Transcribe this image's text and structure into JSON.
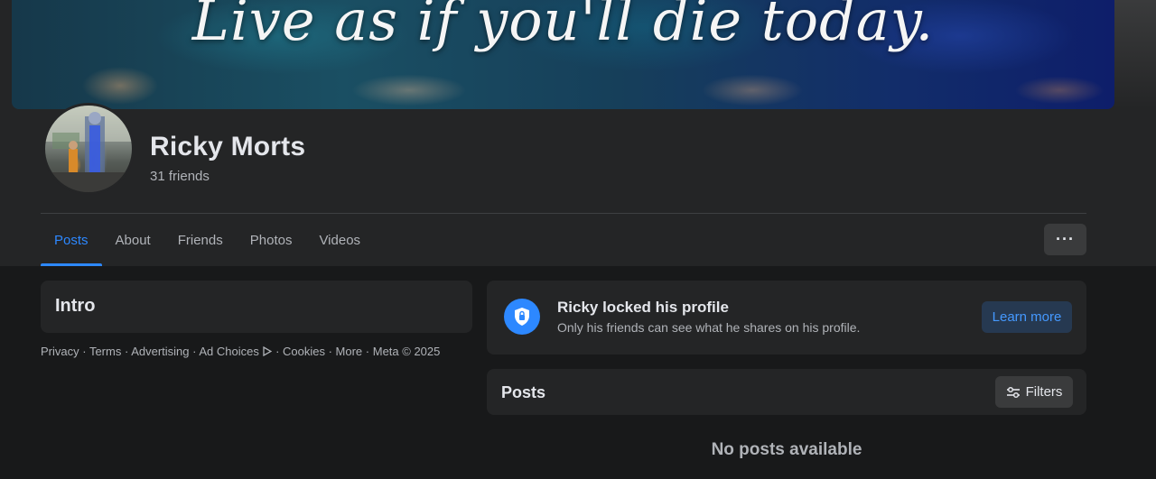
{
  "cover": {
    "quote": "Live as if you'll die today."
  },
  "profile": {
    "name": "Ricky Morts",
    "friends": "31 friends"
  },
  "tabs": [
    {
      "label": "Posts",
      "active": true
    },
    {
      "label": "About"
    },
    {
      "label": "Friends"
    },
    {
      "label": "Photos"
    },
    {
      "label": "Videos"
    }
  ],
  "more_button": {
    "label": "···",
    "icon": "more-horizontal-icon"
  },
  "intro": {
    "title": "Intro"
  },
  "footer": {
    "links": [
      "Privacy",
      "Terms",
      "Advertising",
      "Ad Choices",
      "Cookies",
      "More"
    ],
    "separator": " · ",
    "ad_choices_icon": "ad-choices-icon",
    "copyright": "Meta © 2025"
  },
  "locked_notice": {
    "title": "Ricky locked his profile",
    "description": "Only his friends can see what he shares on his profile.",
    "button": "Learn more",
    "icon": "shield-lock-icon"
  },
  "posts_section": {
    "title": "Posts",
    "filters_label": "Filters",
    "filters_icon": "sliders-icon",
    "empty_message": "No posts available"
  },
  "colors": {
    "background": "#18191a",
    "card": "#242526",
    "accent": "#2d88ff",
    "text_primary": "#e4e6eb",
    "text_secondary": "#b0b3b8"
  }
}
